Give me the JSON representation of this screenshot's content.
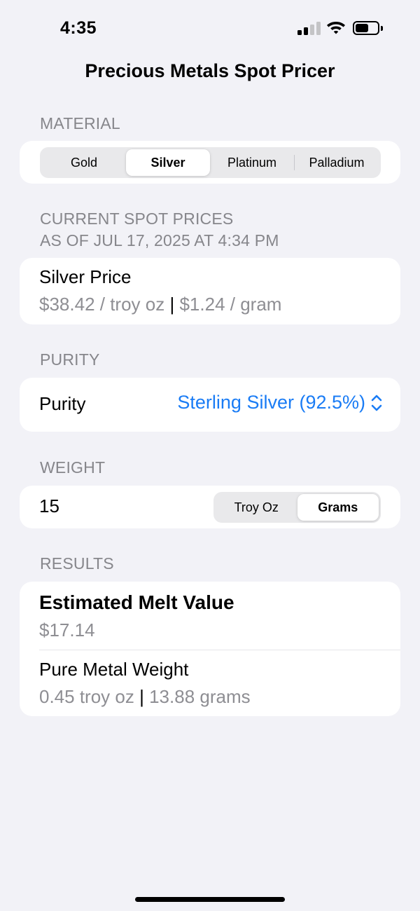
{
  "status_bar": {
    "time": "4:35"
  },
  "title": "Precious Metals Spot Pricer",
  "material": {
    "header": "MATERIAL",
    "options": [
      "Gold",
      "Silver",
      "Platinum",
      "Palladium"
    ],
    "selected": "Silver"
  },
  "spot": {
    "header_line1": "CURRENT SPOT PRICES",
    "header_line2": "AS OF JUL 17, 2025 AT 4:34 PM",
    "label": "Silver Price",
    "per_oz": "$38.42 / troy oz",
    "separator": "|",
    "per_gram": "$1.24 / gram"
  },
  "purity": {
    "header": "PURITY",
    "label": "Purity",
    "value": "Sterling Silver (92.5%)",
    "chevron_icon": "chevron-up-down-icon"
  },
  "weight": {
    "header": "WEIGHT",
    "value": "15",
    "units": [
      "Troy Oz",
      "Grams"
    ],
    "selected_unit": "Grams"
  },
  "results": {
    "header": "RESULTS",
    "melt_label": "Estimated Melt Value",
    "melt_value": "$17.14",
    "pure_label": "Pure Metal Weight",
    "pure_oz": "0.45 troy oz",
    "separator": "|",
    "pure_grams": "13.88 grams"
  },
  "colors": {
    "background": "#F2F2F7",
    "accent": "#1A7CF5",
    "secondary_text": "#8E8E93"
  }
}
